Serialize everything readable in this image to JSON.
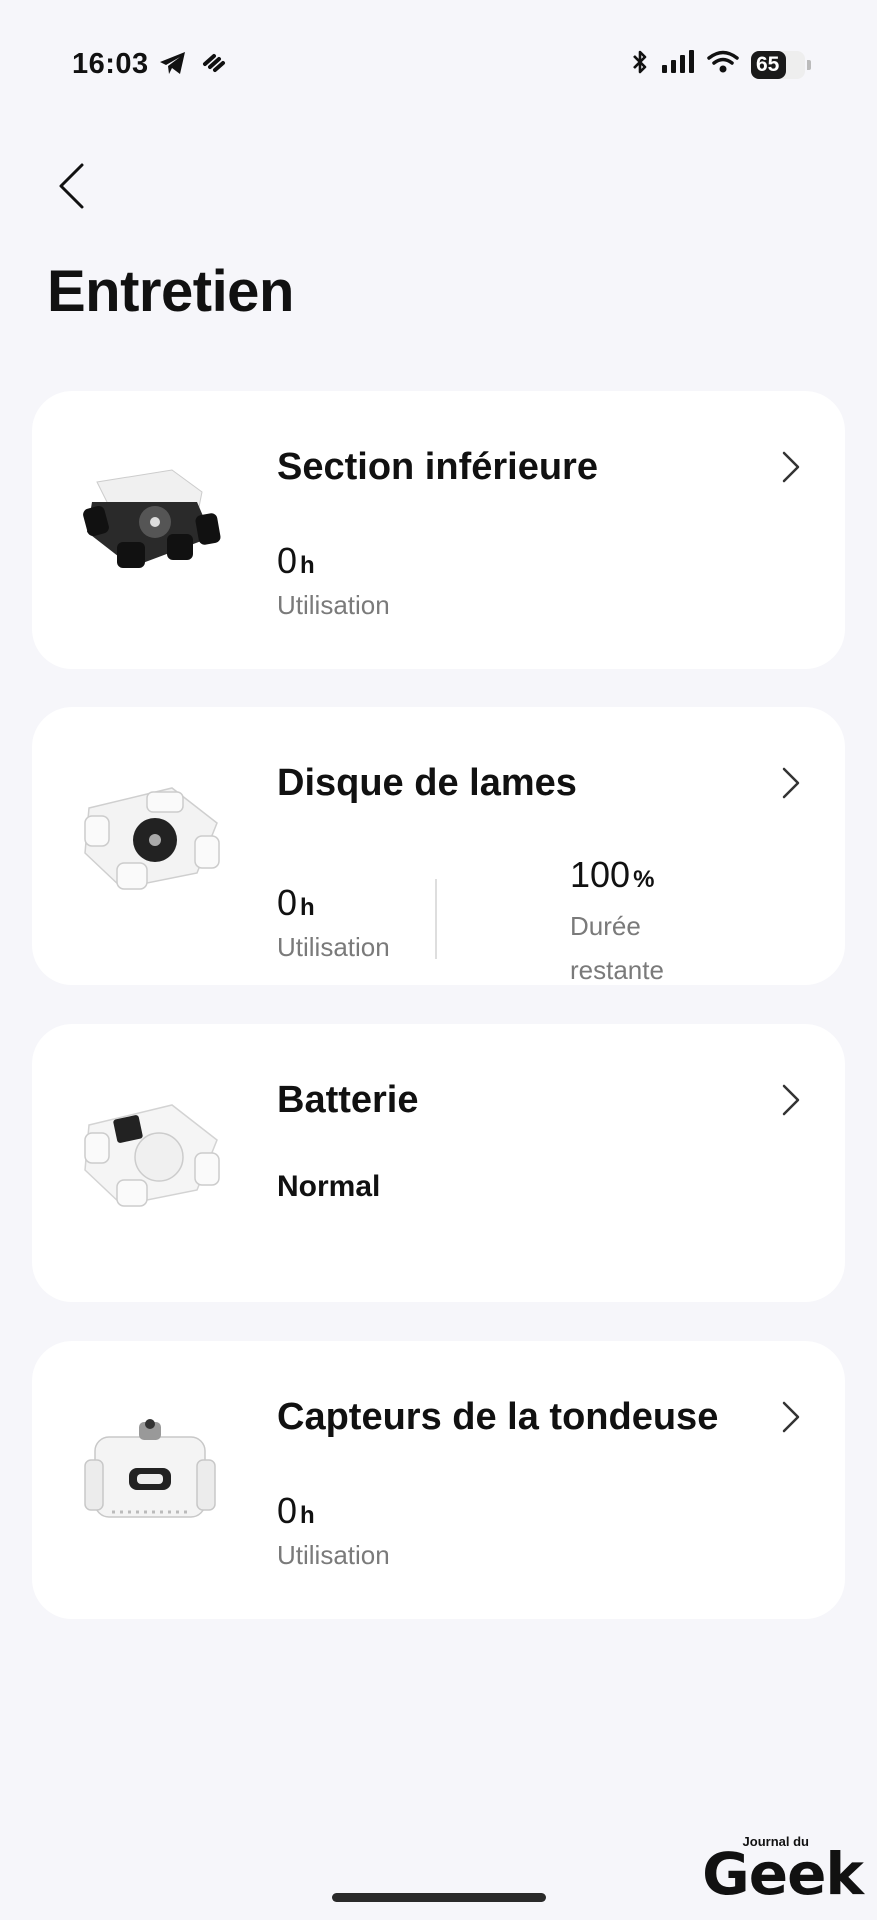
{
  "status_bar": {
    "time": "16:03",
    "battery_level": "65",
    "battery_fraction": 0.65,
    "icons": [
      "telegram-icon",
      "app-notification-icon",
      "bluetooth-icon",
      "signal-icon",
      "wifi-icon",
      "battery-icon"
    ]
  },
  "header": {
    "back_icon": "chevron-left-icon",
    "title": "Entretien"
  },
  "cards": [
    {
      "title": "Section inférieure",
      "image": "mower-underside-image",
      "usage_value": "0",
      "usage_unit": "h",
      "usage_label": "Utilisation"
    },
    {
      "title": "Disque de lames",
      "image": "blade-disc-image",
      "usage_value": "0",
      "usage_unit": "h",
      "usage_label": "Utilisation",
      "remaining_value": "100",
      "remaining_unit": "%",
      "remaining_label": "Durée restante"
    },
    {
      "title": "Batterie",
      "image": "battery-image",
      "status": "Normal"
    },
    {
      "title": "Capteurs de la tondeuse",
      "image": "mower-sensors-image",
      "usage_value": "0",
      "usage_unit": "h",
      "usage_label": "Utilisation"
    }
  ],
  "watermark": {
    "small": "Journal du",
    "big": "Geek"
  }
}
